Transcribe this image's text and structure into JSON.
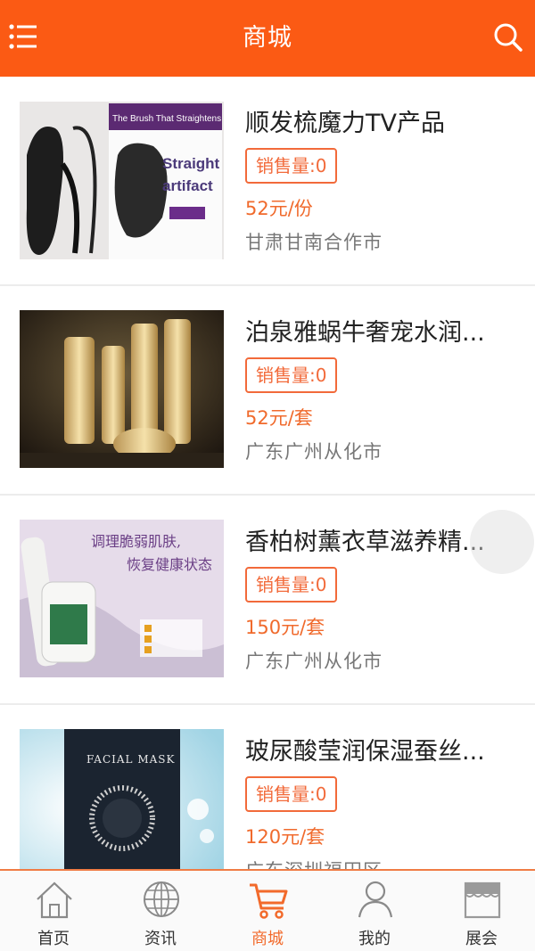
{
  "header": {
    "title": "商城",
    "menu_icon": "menu-icon",
    "search_icon": "search-icon"
  },
  "products": [
    {
      "name": "顺发梳魔力TV产品",
      "sales": "销售量:0",
      "price": "52元/份",
      "location": "甘肃甘南合作市",
      "image_text": {
        "line1": "The Brush That Straightens Hair!",
        "line2": "Straight",
        "line3": "artifact"
      }
    },
    {
      "name": "泊泉雅蜗牛奢宠水润...",
      "sales": "销售量:0",
      "price": "52元/套",
      "location": "广东广州从化市"
    },
    {
      "name": "香柏树薰衣草滋养精...",
      "sales": "销售量:0",
      "price": "150元/套",
      "location": "广东广州从化市",
      "image_text": {
        "line1": "调理脆弱肌肤,",
        "line2": "恢复健康状态"
      }
    },
    {
      "name": "玻尿酸莹润保湿蚕丝...",
      "sales": "销售量:0",
      "price": "120元/套",
      "location": "广东深圳福田区",
      "image_text": {
        "line1": "FACIAL MASK"
      }
    }
  ],
  "tabs": [
    {
      "label": "首页",
      "icon": "home-icon"
    },
    {
      "label": "资讯",
      "icon": "globe-icon"
    },
    {
      "label": "商城",
      "icon": "cart-icon",
      "active": true
    },
    {
      "label": "我的",
      "icon": "user-icon"
    },
    {
      "label": "展会",
      "icon": "store-icon"
    }
  ],
  "colors": {
    "brand": "#fb5a14",
    "accent": "#f26a2b",
    "muted": "#777777"
  }
}
